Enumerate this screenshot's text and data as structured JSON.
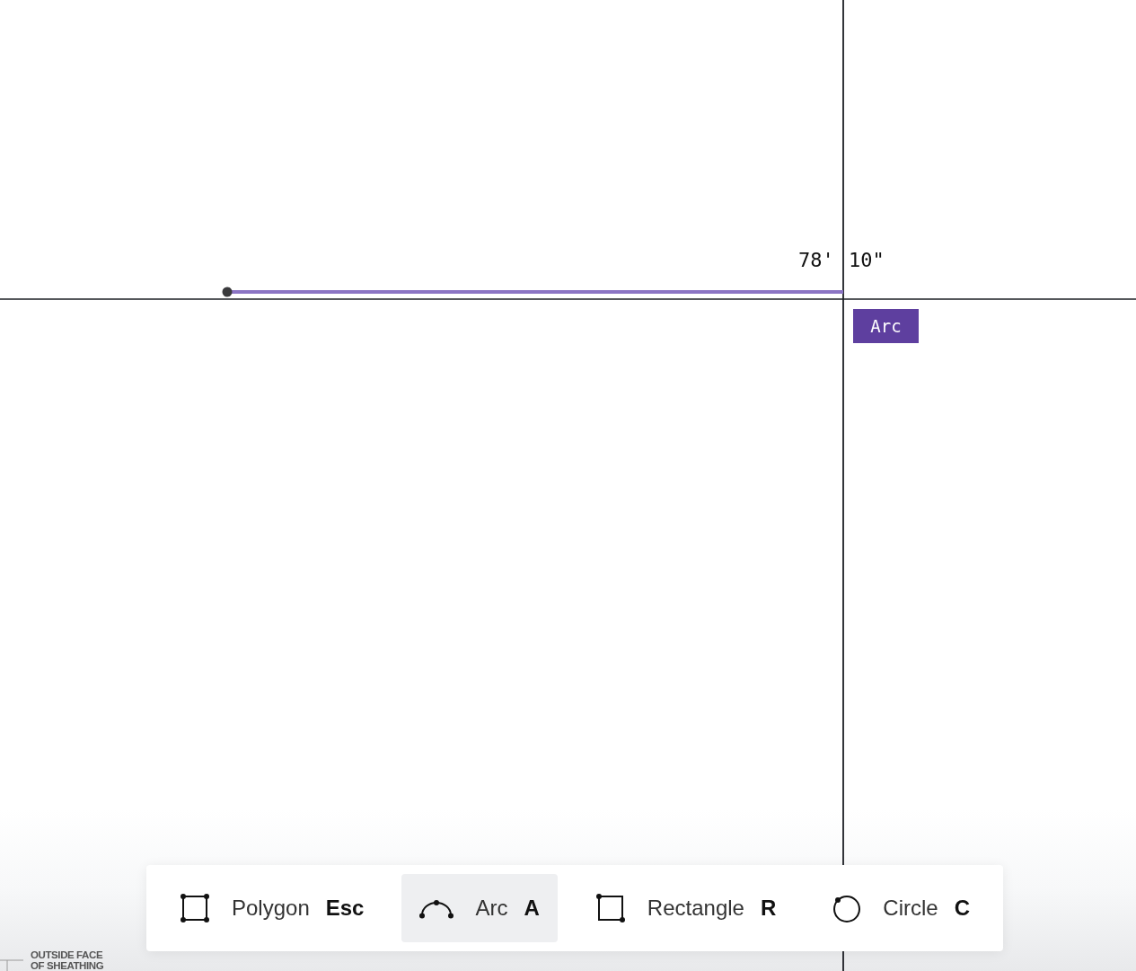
{
  "canvas": {
    "dimension": {
      "feet": "78'",
      "inches": "10\""
    },
    "cursor_tooltip": "Arc",
    "plan_note": "OUTSIDE FACE OF SHEATHING"
  },
  "toolbar": {
    "tools": [
      {
        "kind": "polygon",
        "label": "Polygon",
        "shortcut": "Esc",
        "selected": false
      },
      {
        "kind": "arc",
        "label": "Arc",
        "shortcut": "A",
        "selected": true
      },
      {
        "kind": "rectangle",
        "label": "Rectangle",
        "shortcut": "R",
        "selected": false
      },
      {
        "kind": "circle",
        "label": "Circle",
        "shortcut": "C",
        "selected": false
      }
    ]
  }
}
